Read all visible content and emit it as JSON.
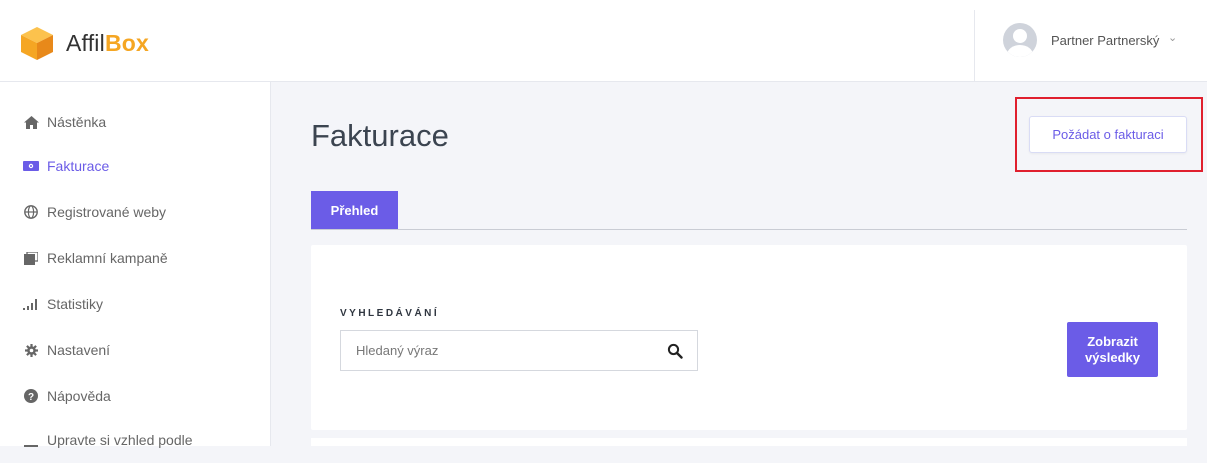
{
  "app": {
    "logo_text_main": "Affil",
    "logo_text_accent": "Box",
    "brand_color": "#f5a623",
    "accent_color": "#6b5ce7"
  },
  "user": {
    "name": "Partner Partnerský",
    "chevron": "⌄",
    "avatar_icon": "user-avatar"
  },
  "sidebar": {
    "items": [
      {
        "label": "Nástěnka",
        "icon": "home-icon",
        "active": false
      },
      {
        "label": "Fakturace",
        "icon": "money-icon",
        "active": true
      },
      {
        "label": "Registrované weby",
        "icon": "globe-icon",
        "active": false
      },
      {
        "label": "Reklamní kampaně",
        "icon": "tablet-icon",
        "active": false
      },
      {
        "label": "Statistiky",
        "icon": "signal-bars-icon",
        "active": false
      },
      {
        "label": "Nastavení",
        "icon": "gear-icon",
        "active": false
      },
      {
        "label": "Nápověda",
        "icon": "question-circle-icon",
        "active": false
      },
      {
        "label": "Upravte si vzhled podle",
        "icon": "palette-icon",
        "active": false
      }
    ]
  },
  "main": {
    "title": "Fakturace",
    "request_button": "Požádat o fakturaci",
    "tabs": [
      {
        "label": "Přehled",
        "active": true
      }
    ],
    "search": {
      "label": "VYHLEDÁVÁNÍ",
      "placeholder": "Hledaný výraz",
      "value": ""
    },
    "results_button": "Zobrazit výsledky"
  }
}
